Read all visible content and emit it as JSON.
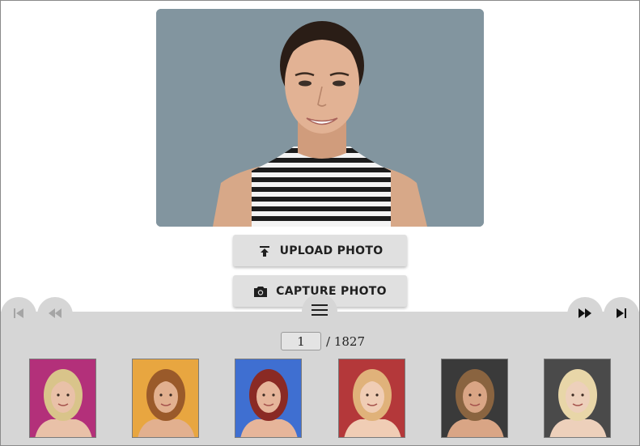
{
  "main_photo": {
    "alt": "Uploaded portrait photo"
  },
  "buttons": {
    "upload_label": "UPLOAD PHOTO",
    "capture_label": "CAPTURE PHOTO"
  },
  "pager": {
    "current_page": "1",
    "total_text": "/ 1827"
  },
  "icons": {
    "first": "skip-to-start-icon",
    "prev": "rewind-icon",
    "menu": "hamburger-menu-icon",
    "next": "fast-forward-icon",
    "last": "skip-to-end-icon",
    "upload": "upload-icon",
    "camera": "camera-icon"
  },
  "thumbnails": [
    {
      "bg": "#b3307a",
      "hair": "#d9c48a",
      "skin": "#e9c1a8"
    },
    {
      "bg": "#e8a640",
      "hair": "#9a5a2a",
      "skin": "#e2b08f"
    },
    {
      "bg": "#3f6fd1",
      "hair": "#8a2a24",
      "skin": "#e6b59a"
    },
    {
      "bg": "#b4383a",
      "hair": "#e0b27a",
      "skin": "#f0cdb5"
    },
    {
      "bg": "#3a3a3a",
      "hair": "#8a6440",
      "skin": "#d9a585"
    },
    {
      "bg": "#4a4a4a",
      "hair": "#e8d6a8",
      "skin": "#edd0bb"
    }
  ],
  "colors": {
    "panel": "#d6d6d6",
    "photo_bg": "#82959f",
    "button": "#e0e0e0"
  }
}
